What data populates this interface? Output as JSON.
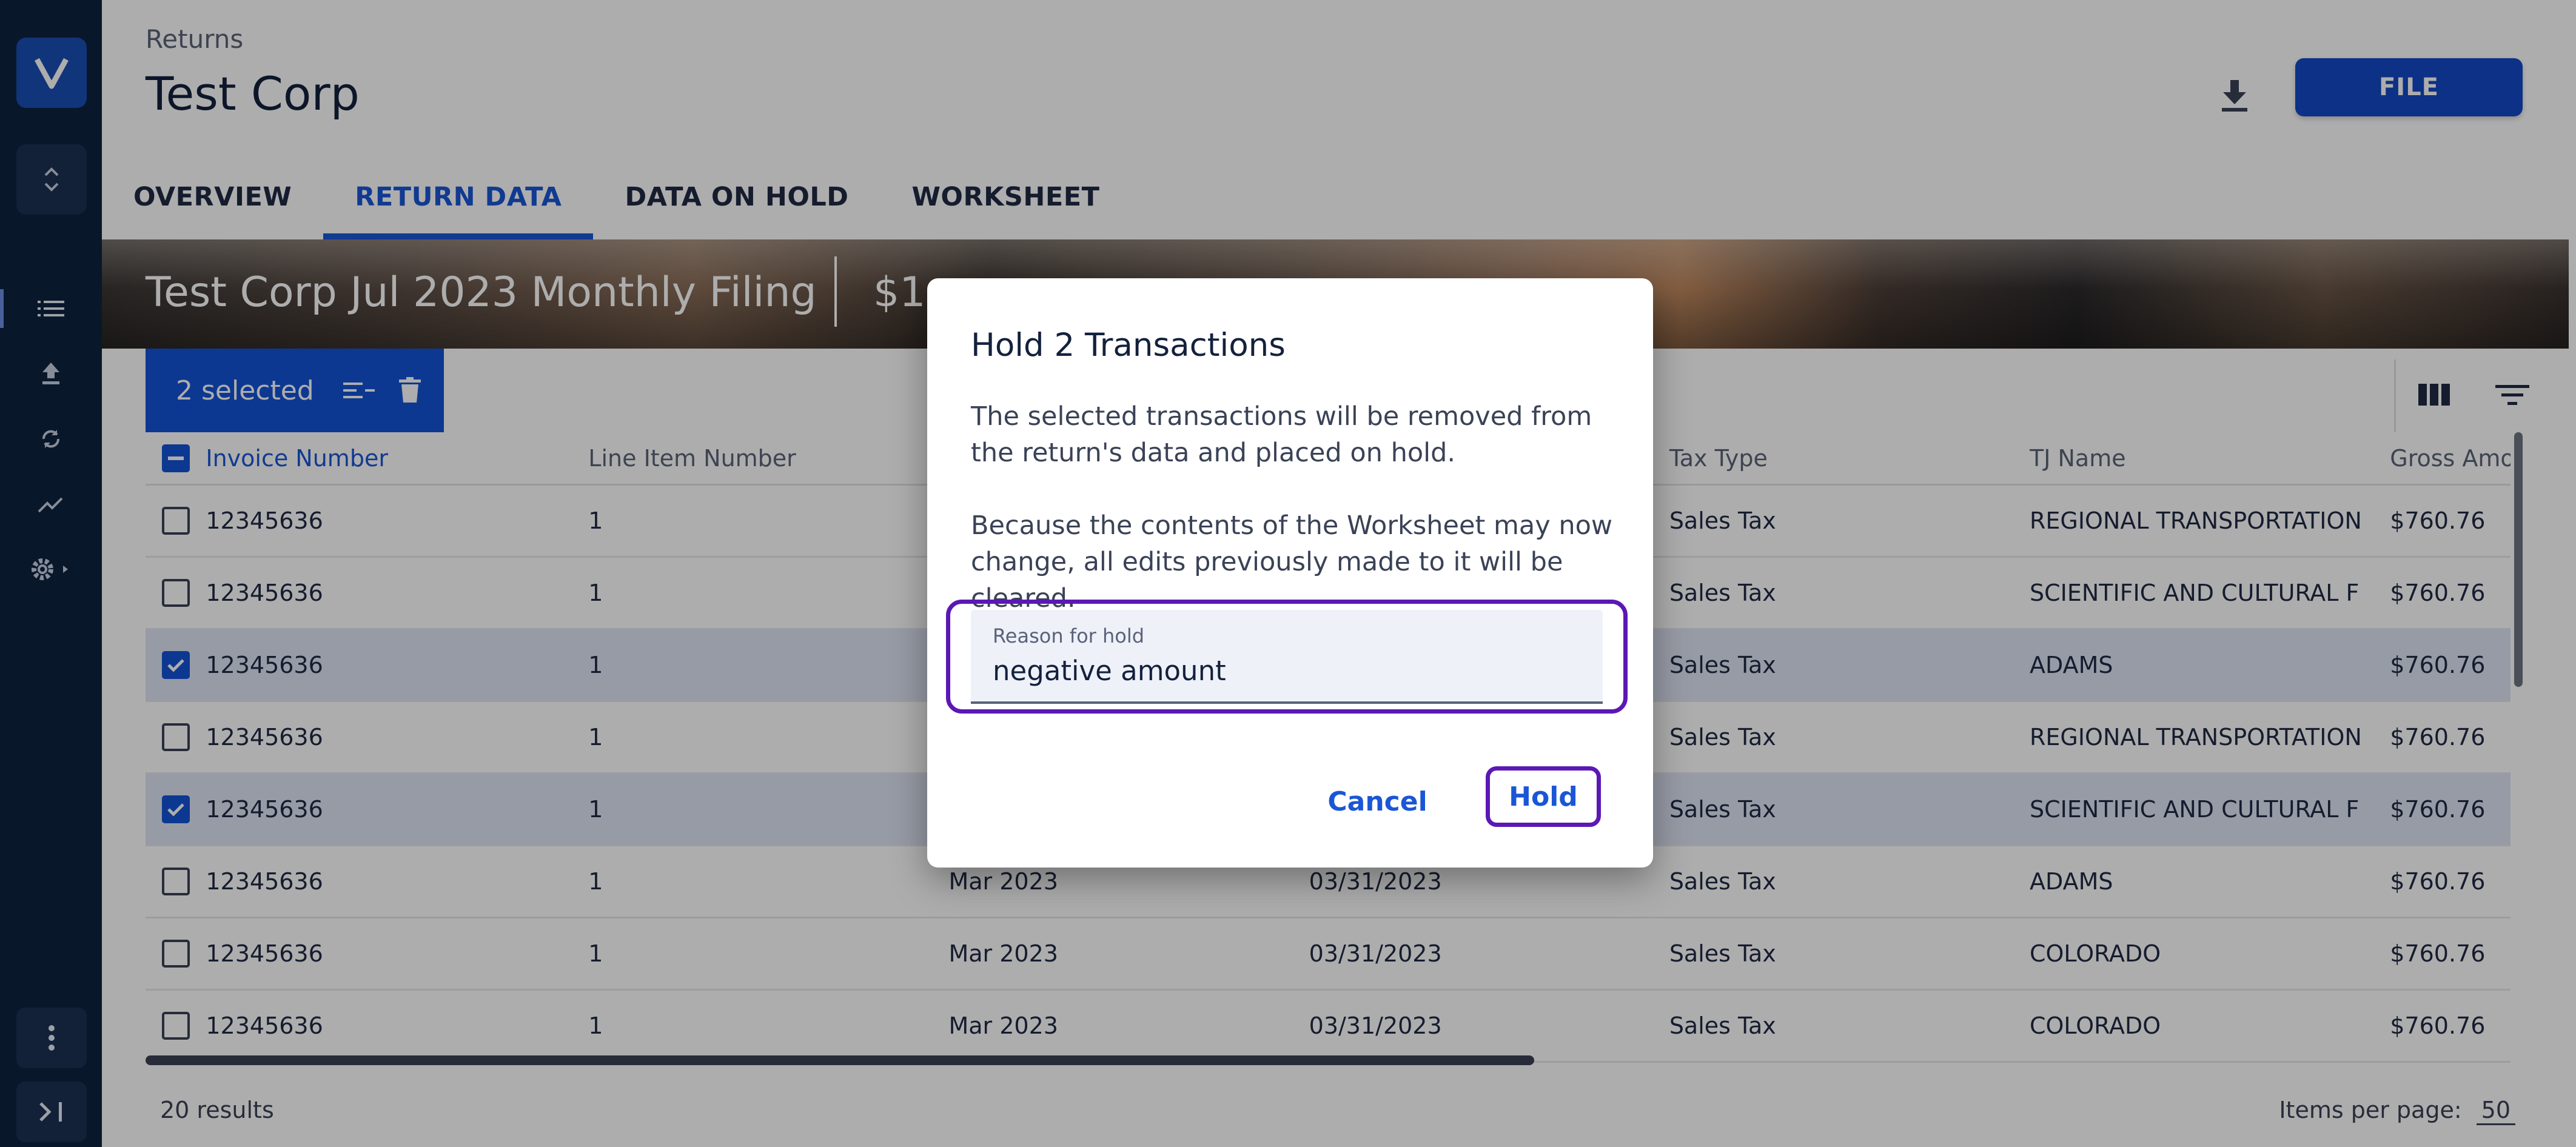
{
  "header": {
    "breadcrumb": "Returns",
    "title": "Test Corp",
    "file_button": "FILE"
  },
  "tabs": [
    {
      "label": "OVERVIEW",
      "active": false
    },
    {
      "label": "RETURN DATA",
      "active": true
    },
    {
      "label": "DATA ON HOLD",
      "active": false
    },
    {
      "label": "WORKSHEET",
      "active": false
    }
  ],
  "banner": {
    "title": "Test Corp Jul 2023 Monthly Filing",
    "amount": "$1"
  },
  "selection_bar": {
    "label": "2 selected"
  },
  "table": {
    "columns": [
      "Invoice Number",
      "Line Item Number",
      "",
      "",
      "Tax Type",
      "TJ Name",
      "Gross Amo"
    ],
    "rows": [
      {
        "checked": false,
        "invoice": "12345636",
        "line": "1",
        "period": "",
        "date": "",
        "tax_type": "Sales Tax",
        "tj_name": "REGIONAL TRANSPORTATION",
        "gross": "$760.76"
      },
      {
        "checked": false,
        "invoice": "12345636",
        "line": "1",
        "period": "",
        "date": "",
        "tax_type": "Sales Tax",
        "tj_name": "SCIENTIFIC AND CULTURAL F",
        "gross": "$760.76"
      },
      {
        "checked": true,
        "invoice": "12345636",
        "line": "1",
        "period": "",
        "date": "",
        "tax_type": "Sales Tax",
        "tj_name": "ADAMS",
        "gross": "$760.76"
      },
      {
        "checked": false,
        "invoice": "12345636",
        "line": "1",
        "period": "",
        "date": "",
        "tax_type": "Sales Tax",
        "tj_name": "REGIONAL TRANSPORTATION",
        "gross": "$760.76"
      },
      {
        "checked": true,
        "invoice": "12345636",
        "line": "1",
        "period": "",
        "date": "",
        "tax_type": "Sales Tax",
        "tj_name": "SCIENTIFIC AND CULTURAL F",
        "gross": "$760.76"
      },
      {
        "checked": false,
        "invoice": "12345636",
        "line": "1",
        "period": "Mar 2023",
        "date": "03/31/2023",
        "tax_type": "Sales Tax",
        "tj_name": "ADAMS",
        "gross": "$760.76"
      },
      {
        "checked": false,
        "invoice": "12345636",
        "line": "1",
        "period": "Mar 2023",
        "date": "03/31/2023",
        "tax_type": "Sales Tax",
        "tj_name": "COLORADO",
        "gross": "$760.76"
      },
      {
        "checked": false,
        "invoice": "12345636",
        "line": "1",
        "period": "Mar 2023",
        "date": "03/31/2023",
        "tax_type": "Sales Tax",
        "tj_name": "COLORADO",
        "gross": "$760.76"
      }
    ]
  },
  "footer": {
    "results": "20 results",
    "items_per_page_label": "Items per page:",
    "items_per_page_value": "50"
  },
  "dialog": {
    "title": "Hold 2 Transactions",
    "paragraph1": "The selected transactions will be removed from the return's data and placed on hold.",
    "paragraph2": "Because the contents of the Worksheet may now change, all edits previously made to it will be cleared.",
    "field_label": "Reason for hold",
    "field_value": "negative amount",
    "cancel_label": "Cancel",
    "hold_label": "Hold"
  },
  "icons": {
    "logo": "v-logo-icon",
    "switcher": "chevron-updown-icon",
    "nav": [
      "list-icon",
      "upload-icon",
      "sync-icon",
      "trend-icon",
      "gear-icon"
    ],
    "bottom": [
      "more-vertical-icon",
      "expand-rail-icon"
    ]
  },
  "colors": {
    "primary": "#1453d6",
    "rail": "#0e2240",
    "focus_outline": "#5b18b5"
  }
}
